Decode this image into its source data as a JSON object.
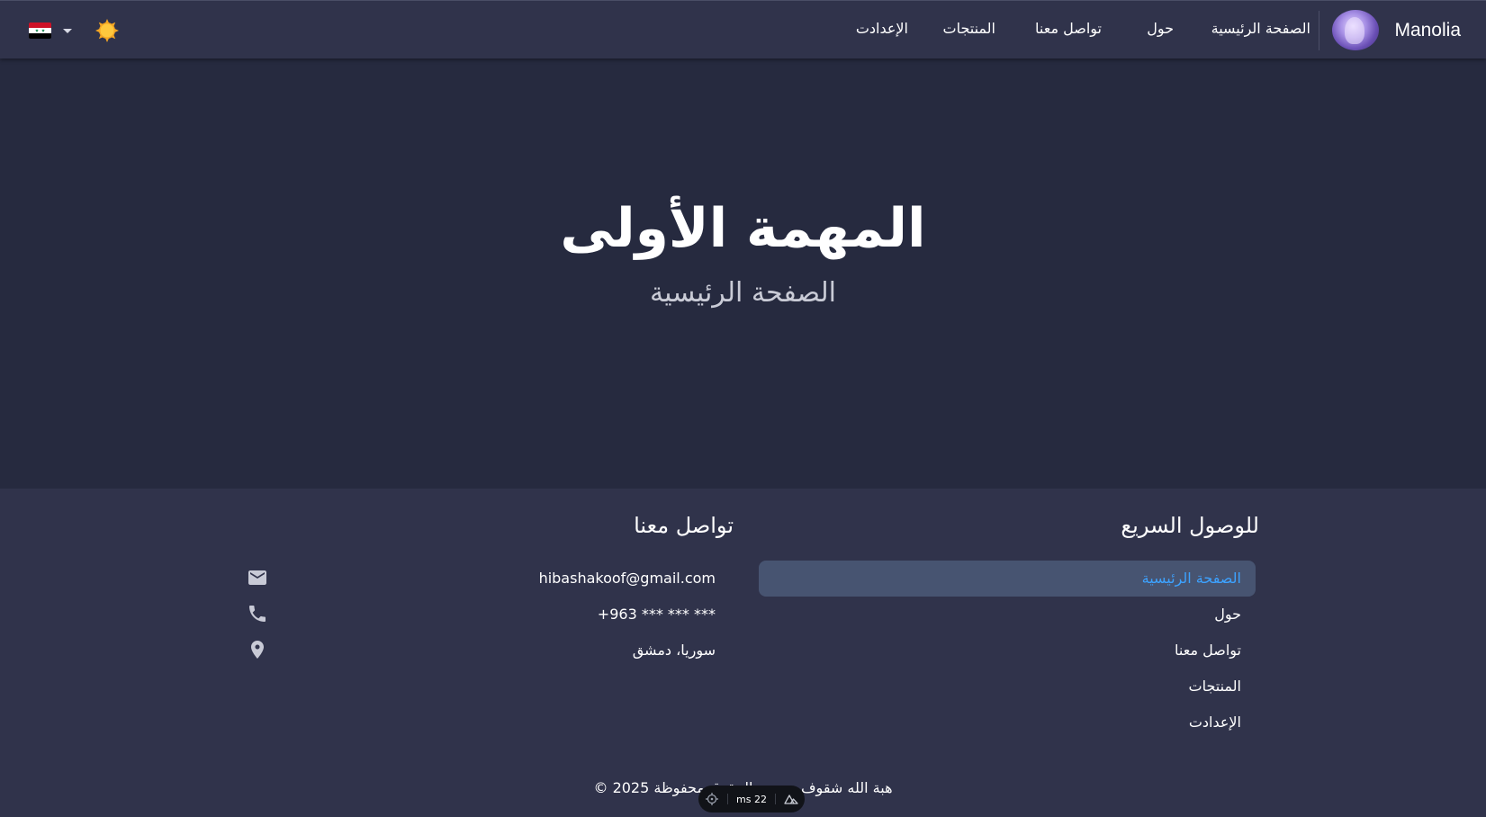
{
  "header": {
    "brand_name": "Manolia",
    "nav": {
      "home": "الصفحة الرئيسية",
      "about": "حول",
      "contact": "تواصل معنا",
      "products": "المنتجات",
      "settings": "الإعدادت"
    },
    "theme_icon": "sun-icon",
    "language_flag": "syria-flag"
  },
  "hero": {
    "title": "المهمة الأولى",
    "subtitle": "الصفحة الرئيسية"
  },
  "footer": {
    "quick_access": {
      "title": "للوصول السريع",
      "links": [
        "الصفحة الرئيسية",
        "حول",
        "تواصل معنا",
        "المنتجات",
        "الإعدادت"
      ],
      "active_index": 0
    },
    "contact": {
      "title": "تواصل معنا",
      "email": "hibashakoof@gmail.com",
      "phone": "+963 *** *** ***",
      "location": "سوريا، دمشق",
      "icons": [
        "mail-icon",
        "phone-icon",
        "location-pin-icon"
      ]
    },
    "copyright": "هبة الله شقوف - جميع الحقوق محفوظة 2025 ©"
  },
  "devtool": {
    "timing": "22 ms"
  },
  "colors": {
    "page_background": "#262a3f",
    "header_background": "#30334b",
    "footer_background": "#30334b",
    "active_link_background": "#475471",
    "active_link_text": "#3da2ff"
  }
}
